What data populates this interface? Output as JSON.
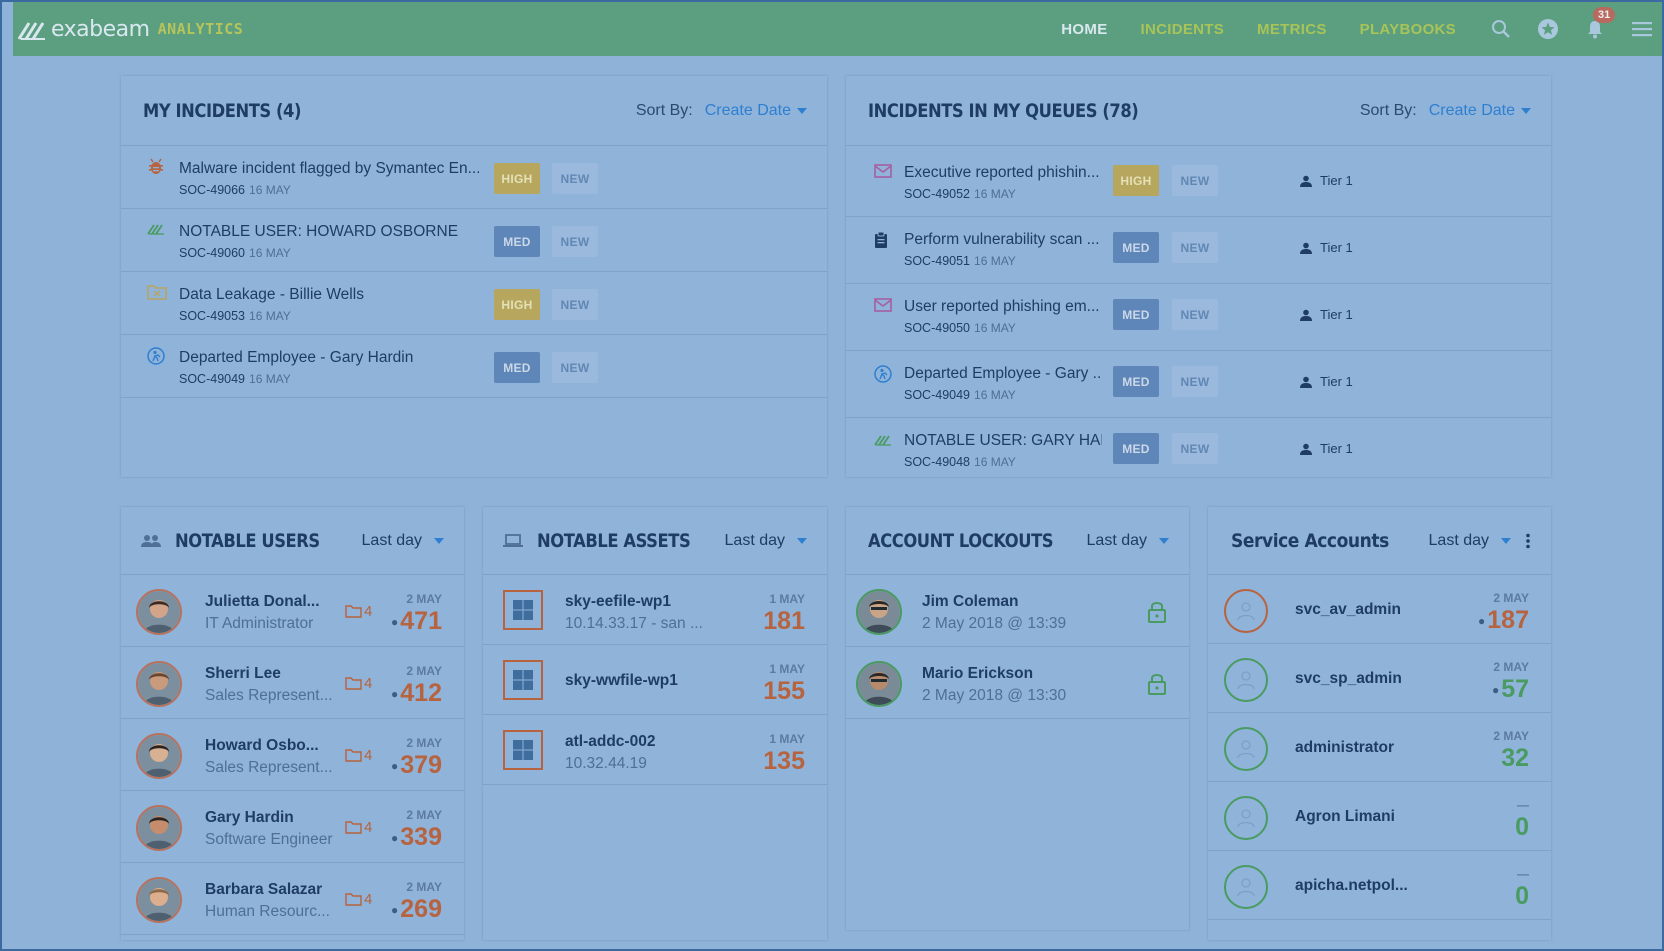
{
  "nav": {
    "brand_name": "exabeam",
    "brand_sub": "ANALYTICS",
    "links": [
      "HOME",
      "INCIDENTS",
      "METRICS",
      "PLAYBOOKS"
    ],
    "notif_count": "31"
  },
  "my_incidents": {
    "title": "MY INCIDENTS (4)",
    "sort_label": "Sort By:",
    "sort_value": "Create Date",
    "rows": [
      {
        "icon": "bug-icon",
        "title": "Malware incident flagged by Symantec En...",
        "id": "SOC-49066",
        "date": "16 MAY",
        "severity": "HIGH",
        "status": "NEW"
      },
      {
        "icon": "exabeam-logo-icon",
        "title": "NOTABLE USER: HOWARD OSBORNE",
        "id": "SOC-49060",
        "date": "16 MAY",
        "severity": "MED",
        "status": "NEW"
      },
      {
        "icon": "folder-x-icon",
        "title": "Data Leakage - Billie Wells",
        "id": "SOC-49053",
        "date": "16 MAY",
        "severity": "HIGH",
        "status": "NEW"
      },
      {
        "icon": "departed-employee-icon",
        "title": "Departed Employee - Gary Hardin",
        "id": "SOC-49049",
        "date": "16 MAY",
        "severity": "MED",
        "status": "NEW"
      }
    ]
  },
  "queue_incidents": {
    "title": "INCIDENTS IN MY QUEUES (78)",
    "sort_label": "Sort By:",
    "sort_value": "Create Date",
    "rows": [
      {
        "icon": "mail-icon",
        "title": "Executive reported phishin...",
        "id": "SOC-49052",
        "date": "16 MAY",
        "severity": "HIGH",
        "status": "NEW",
        "queue": "Tier 1"
      },
      {
        "icon": "clipboard-icon",
        "title": "Perform vulnerability scan ...",
        "id": "SOC-49051",
        "date": "16 MAY",
        "severity": "MED",
        "status": "NEW",
        "queue": "Tier 1"
      },
      {
        "icon": "mail-icon",
        "title": "User reported phishing em...",
        "id": "SOC-49050",
        "date": "16 MAY",
        "severity": "MED",
        "status": "NEW",
        "queue": "Tier 1"
      },
      {
        "icon": "departed-employee-icon",
        "title": "Departed Employee - Gary ...",
        "id": "SOC-49049",
        "date": "16 MAY",
        "severity": "MED",
        "status": "NEW",
        "queue": "Tier 1"
      },
      {
        "icon": "exabeam-logo-icon",
        "title": "NOTABLE USER: GARY HAR...",
        "id": "SOC-49048",
        "date": "16 MAY",
        "severity": "MED",
        "status": "NEW",
        "queue": "Tier 1"
      }
    ]
  },
  "notable_users": {
    "title": "NOTABLE USERS",
    "period": "Last day",
    "rows": [
      {
        "name": "Julietta Donal...",
        "role": "IT Administrator",
        "files": "4",
        "date": "2 MAY",
        "score": "471"
      },
      {
        "name": "Sherri Lee",
        "role": "Sales Represent...",
        "files": "4",
        "date": "2 MAY",
        "score": "412"
      },
      {
        "name": "Howard Osbo...",
        "role": "Sales Represent...",
        "files": "4",
        "date": "2 MAY",
        "score": "379"
      },
      {
        "name": "Gary Hardin",
        "role": "Software Engineer",
        "files": "4",
        "date": "2 MAY",
        "score": "339"
      },
      {
        "name": "Barbara Salazar",
        "role": "Human Resourc...",
        "files": "4",
        "date": "2 MAY",
        "score": "269"
      }
    ]
  },
  "notable_assets": {
    "title": "NOTABLE ASSETS",
    "period": "Last day",
    "rows": [
      {
        "name": "sky-eefile-wp1",
        "sub": "10.14.33.17 - san ...",
        "date": "1 MAY",
        "score": "181"
      },
      {
        "name": "sky-wwfile-wp1",
        "sub": "",
        "date": "1 MAY",
        "score": "155"
      },
      {
        "name": "atl-addc-002",
        "sub": "10.32.44.19",
        "date": "1 MAY",
        "score": "135"
      }
    ]
  },
  "account_lockouts": {
    "title": "ACCOUNT LOCKOUTS",
    "period": "Last day",
    "rows": [
      {
        "name": "Jim Coleman",
        "time": "2 May 2018 @ 13:39"
      },
      {
        "name": "Mario Erickson",
        "time": "2 May 2018 @ 13:30"
      }
    ]
  },
  "service_accounts": {
    "title": "Service Accounts",
    "period": "Last day",
    "rows": [
      {
        "name": "svc_av_admin",
        "date": "2 MAY",
        "score": "187",
        "level": "high"
      },
      {
        "name": "svc_sp_admin",
        "date": "2 MAY",
        "score": "57",
        "level": "low"
      },
      {
        "name": "administrator",
        "date": "2 MAY",
        "score": "32",
        "level": "low"
      },
      {
        "name": "Agron Limani",
        "date": "—",
        "score": "0",
        "level": "low"
      },
      {
        "name": "apicha.netpol...",
        "date": "—",
        "score": "0",
        "level": "low"
      }
    ]
  },
  "colors": {
    "nav_bg": "#5b9f80",
    "high": "#b7a65e",
    "med": "#5e86b8",
    "score_high": "#b7633f",
    "score_low": "#4a9b62",
    "link": "#2f7fd1"
  }
}
